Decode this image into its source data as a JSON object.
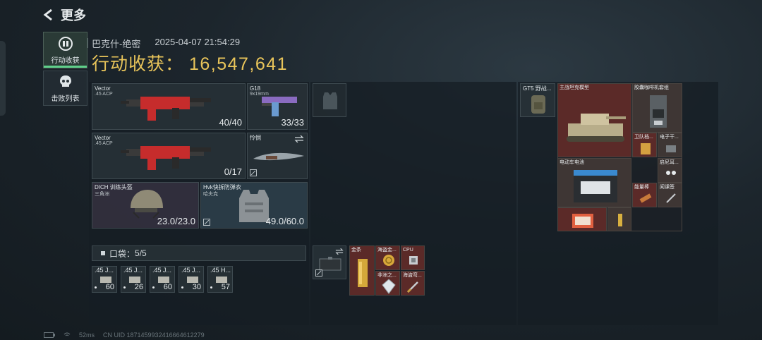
{
  "header": {
    "back_label": "更多"
  },
  "nav": [
    {
      "label": "行动收获",
      "active": true
    },
    {
      "label": "击败列表",
      "active": false
    }
  ],
  "summary": {
    "map": "巴克什-绝密",
    "datetime": "2025-04-07 21:54:29",
    "harvest_label": "行动收获：",
    "harvest_value": "16,547,641"
  },
  "loadout": {
    "primary1": {
      "name": "Vector",
      "ammo": ".45 ACP",
      "count": "40/40"
    },
    "pistol": {
      "name": "G18",
      "ammo": "9x19mm",
      "count": "33/33"
    },
    "primary2": {
      "name": "Vector",
      "ammo": ".45 ACP",
      "count": "0/17"
    },
    "melee": {
      "name": "怜悯"
    },
    "helmet": {
      "name": "DICH 训练头盔",
      "sub": "三角洲",
      "count": "23.0/23.0"
    },
    "armor": {
      "name": "Hvk快拆防弹衣",
      "sub": "哈夫克",
      "count": "49.0/60.0"
    }
  },
  "pocket": {
    "label": "口袋：",
    "value": "5/5",
    "items": [
      {
        "name": ".45 J...",
        "count": "60"
      },
      {
        "name": ".45 J...",
        "count": "26"
      },
      {
        "name": ".45 J...",
        "count": "60"
      },
      {
        "name": ".45 J...",
        "count": "30"
      },
      {
        "name": ".45 H...",
        "count": "57"
      }
    ]
  },
  "secure_items": [
    {
      "name": "金条"
    },
    {
      "name": "海盗金..."
    },
    {
      "name": "CPU"
    },
    {
      "name": "非洲之..."
    },
    {
      "name": "海盗弯..."
    }
  ],
  "backpack": {
    "slot": {
      "name": "GT5 野战..."
    },
    "items": [
      {
        "name": "主战坦克模型"
      },
      {
        "name": "胶囊咖啡机套组"
      },
      {
        "name": "卫队档..."
      },
      {
        "name": "电子干..."
      },
      {
        "name": "电动车电池"
      },
      {
        "name": "启尼耳..."
      },
      {
        "name": "能量棒"
      },
      {
        "name": "闻课签"
      }
    ]
  },
  "footer": {
    "ping": "52ms",
    "uid": "CN UID 1871459932416664612279"
  },
  "colors": {
    "accent_gold": "#e8c45a",
    "accent_green": "#5fd08a",
    "red_rarity": "#6b2a2a"
  }
}
